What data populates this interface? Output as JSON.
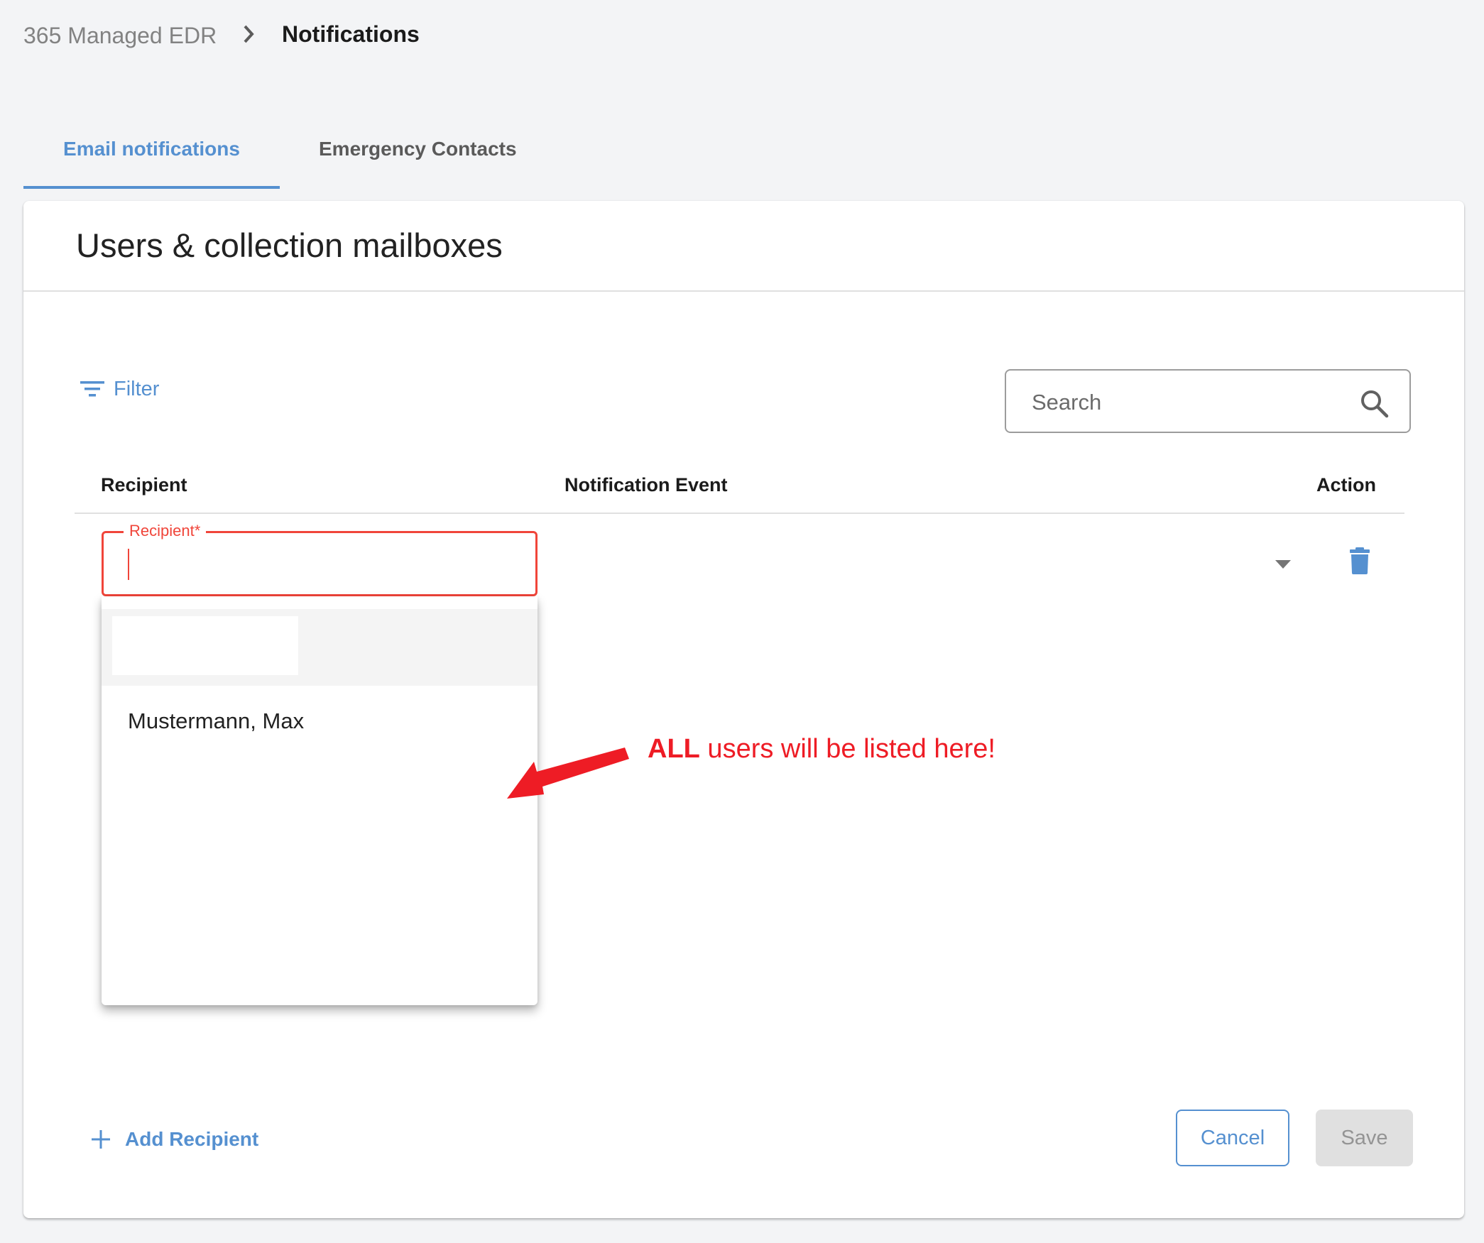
{
  "breadcrumb": {
    "root": "365 Managed EDR",
    "separator_icon": "chevron-right-icon",
    "current": "Notifications"
  },
  "tabs": [
    {
      "label": "Email notifications",
      "active": true
    },
    {
      "label": "Emergency Contacts",
      "active": false
    }
  ],
  "card": {
    "title": "Users & collection mailboxes"
  },
  "toolbar": {
    "filter_label": "Filter",
    "filter_icon": "filter-icon",
    "search_placeholder": "Search",
    "search_value": "",
    "search_icon": "search-icon"
  },
  "table": {
    "columns": [
      "Recipient",
      "Notification Event",
      "Action"
    ],
    "rows": [
      {
        "recipient_label": "Recipient*",
        "recipient_value": "",
        "recipient_state": "focused-error",
        "event_value": "",
        "event_icon": "caret-down-icon",
        "action_icon": "trash-icon"
      }
    ]
  },
  "recipient_dropdown": {
    "options": [
      {
        "label": "",
        "redacted": true,
        "highlighted": true
      },
      {
        "label": "Mustermann, Max",
        "redacted": false,
        "highlighted": false
      }
    ]
  },
  "annotation": {
    "emphasis": "ALL",
    "text": " users will be listed here!",
    "color": "#ee1c25"
  },
  "footer": {
    "add_recipient_label": "Add Recipient",
    "cancel_label": "Cancel",
    "save_label": "Save",
    "save_disabled": true
  },
  "colors": {
    "primary": "#5590d0",
    "error": "#f0453a",
    "page_background": "#f3f4f6",
    "disabled_bg": "#e0e0e0"
  }
}
